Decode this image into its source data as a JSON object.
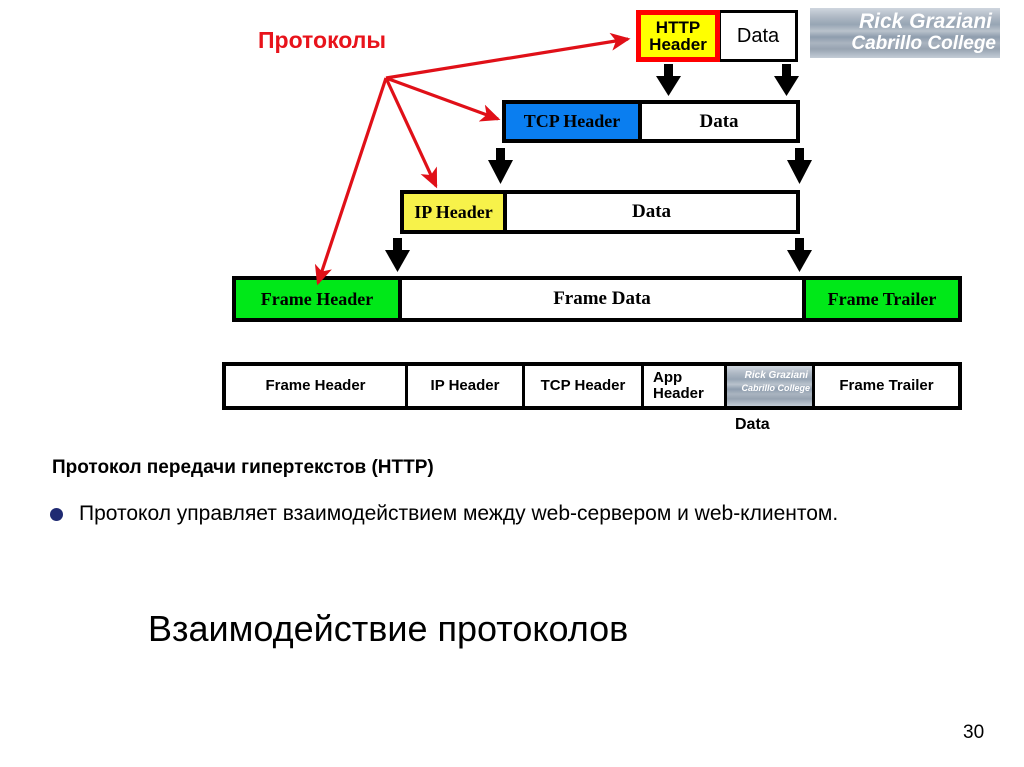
{
  "slide": {
    "page_number": "30",
    "title": "Взаимодействие протоколов",
    "diagram_title": "Протоколы"
  },
  "watermark": {
    "line1": "Rick Graziani",
    "line2": "Cabrillo College"
  },
  "diagram": {
    "layers": [
      {
        "id": "http",
        "header_line1": "HTTP",
        "header_line2": "Header",
        "data_label": "Data",
        "header_fill": "#ffff00",
        "header_border": "#ff0000"
      },
      {
        "id": "tcp",
        "header_label": "TCP Header",
        "data_label": "Data",
        "header_fill": "#0a7ef0"
      },
      {
        "id": "ip",
        "header_label": "IP Header",
        "data_label": "Data",
        "header_fill": "#f7f24a"
      },
      {
        "id": "frame",
        "header_label": "Frame Header",
        "data_label": "Frame Data",
        "trailer_label": "Frame Trailer",
        "header_fill": "#00e818"
      }
    ],
    "summary": {
      "data_caption": "Data",
      "cells": [
        {
          "label": "Frame Header"
        },
        {
          "label": "IP Header"
        },
        {
          "label": "TCP Header"
        },
        {
          "label_line1": "App",
          "label_line2": "Header"
        },
        {
          "label": ""
        },
        {
          "label": "Frame Trailer"
        }
      ]
    }
  },
  "body": {
    "heading": "Протокол передачи гипертекстов  (HTTP)",
    "bullet": "Протокол управляет взаимодействием между web-сервером и web-клиентом."
  }
}
